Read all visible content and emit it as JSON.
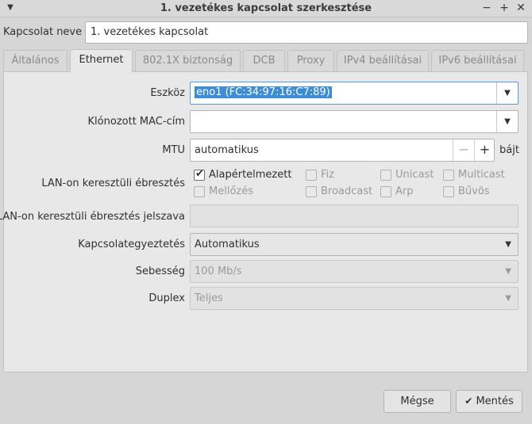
{
  "window": {
    "title": "1. vezetékes kapcsolat szerkesztése",
    "menu_icon": "chevron-down-icon",
    "minimize_icon": "minimize-icon",
    "maximize_icon": "maximize-icon",
    "close_icon": "close-icon"
  },
  "connection": {
    "name_label": "Kapcsolat neve",
    "name_value": "1. vezetékes kapcsolat"
  },
  "tabs": [
    {
      "label": "Általános",
      "active": false
    },
    {
      "label": "Ethernet",
      "active": true
    },
    {
      "label": "802.1X biztonság",
      "active": false
    },
    {
      "label": "DCB",
      "active": false
    },
    {
      "label": "Proxy",
      "active": false
    },
    {
      "label": "IPv4 beállításai",
      "active": false
    },
    {
      "label": "IPv6 beállításai",
      "active": false
    }
  ],
  "ethernet": {
    "device_label": "Eszköz",
    "device_value": "eno1 (FC:34:97:16:C7:89)",
    "cloned_mac_label": "Klónozott MAC-cím",
    "cloned_mac_value": "",
    "mtu_label": "MTU",
    "mtu_value": "automatikus",
    "mtu_minus": "−",
    "mtu_plus": "+",
    "mtu_unit": "bájt",
    "wol_label": "LAN-on keresztüli ébresztés",
    "wol_options": [
      {
        "label": "Alapértelmezett",
        "checked": true,
        "enabled": true
      },
      {
        "label": "Fiz",
        "checked": false,
        "enabled": false
      },
      {
        "label": "Unicast",
        "checked": false,
        "enabled": false
      },
      {
        "label": "Multicast",
        "checked": false,
        "enabled": false
      },
      {
        "label": "Mellőzés",
        "checked": false,
        "enabled": false
      },
      {
        "label": "Broadcast",
        "checked": false,
        "enabled": false
      },
      {
        "label": "Arp",
        "checked": false,
        "enabled": false
      },
      {
        "label": "Bűvös",
        "checked": false,
        "enabled": false
      }
    ],
    "wol_password_label": "LAN-on keresztüli ébresztés jelszava",
    "wol_password_value": "",
    "link_negotiation_label": "Kapcsolategyeztetés",
    "link_negotiation_value": "Automatikus",
    "speed_label": "Sebesség",
    "speed_value": "100 Mb/s",
    "duplex_label": "Duplex",
    "duplex_value": "Teljes"
  },
  "buttons": {
    "cancel": "Mégse",
    "save": "Mentés",
    "save_icon": "checkmark-icon"
  },
  "colors": {
    "selection": "#3d8cd6",
    "window_bg": "#d6d6d6",
    "panel_bg": "#e8e8e8"
  }
}
